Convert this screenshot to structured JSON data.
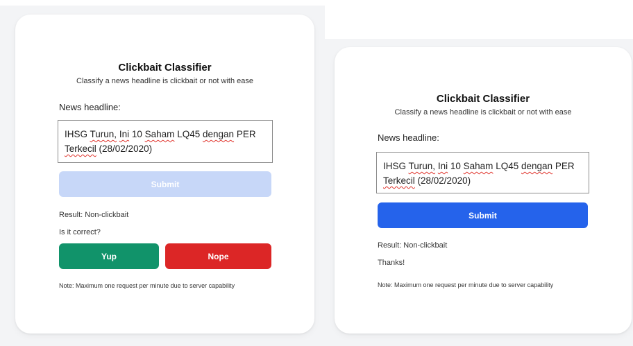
{
  "left_panel": {
    "title": "Clickbait Classifier",
    "subtitle": "Classify a news headline is clickbait or not with ease",
    "headline_label": "News headline:",
    "headline": {
      "w1": "IHSG",
      "w2": "Turun,",
      "w3": "Ini",
      "w4": "10",
      "w5": "Saham",
      "w6": "LQ45",
      "w7": "dengan",
      "w8": "PER",
      "w9": "Terkecil",
      "w10": "(28/02/2020)"
    },
    "submit_label": "Submit",
    "submit_color": "#c7d7f8",
    "result_text": "Result: Non-clickbait",
    "question_text": "Is it correct?",
    "yup_label": "Yup",
    "yup_color": "#11936a",
    "nope_label": "Nope",
    "nope_color": "#dc2626",
    "note": "Note: Maximum one request per minute due to server capability"
  },
  "right_panel": {
    "title": "Clickbait Classifier",
    "subtitle": "Classify a news headline is clickbait or not with ease",
    "headline_label": "News headline:",
    "headline": {
      "w1": "IHSG",
      "w2": "Turun,",
      "w3": "Ini",
      "w4": "10",
      "w5": "Saham",
      "w6": "LQ45",
      "w7": "dengan",
      "w8": "PER",
      "w9": "Terkecil",
      "w10": "(28/02/2020)"
    },
    "submit_label": "Submit",
    "submit_color": "#2563eb",
    "result_text": "Result: Non-clickbait",
    "thanks_text": "Thanks!",
    "note": "Note: Maximum one request per minute due to server capability"
  }
}
